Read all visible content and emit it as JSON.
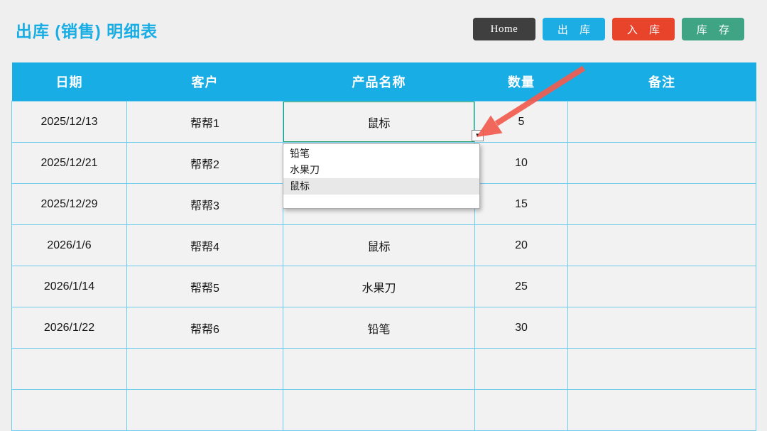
{
  "page": {
    "title": "出库 (销售) 明细表"
  },
  "toolbar": {
    "buttons": [
      {
        "label": "Home",
        "color": "#3f3f3f"
      },
      {
        "label": "出 库",
        "color": "#1cade4"
      },
      {
        "label": "入 库",
        "color": "#e8432b"
      },
      {
        "label": "库 存",
        "color": "#3ea484"
      }
    ]
  },
  "table": {
    "headers": [
      "日期",
      "客户",
      "产品名称",
      "数量",
      "备注"
    ],
    "rows": [
      {
        "date": "2025/12/13",
        "customer": "帮帮1",
        "product": "鼠标",
        "qty": "5",
        "note": ""
      },
      {
        "date": "2025/12/21",
        "customer": "帮帮2",
        "product": "",
        "qty": "10",
        "note": ""
      },
      {
        "date": "2025/12/29",
        "customer": "帮帮3",
        "product": "",
        "qty": "15",
        "note": ""
      },
      {
        "date": "2026/1/6",
        "customer": "帮帮4",
        "product": "鼠标",
        "qty": "20",
        "note": ""
      },
      {
        "date": "2026/1/14",
        "customer": "帮帮5",
        "product": "水果刀",
        "qty": "25",
        "note": ""
      },
      {
        "date": "2026/1/22",
        "customer": "帮帮6",
        "product": "铅笔",
        "qty": "30",
        "note": ""
      },
      {
        "date": "",
        "customer": "",
        "product": "",
        "qty": "",
        "note": ""
      },
      {
        "date": "",
        "customer": "",
        "product": "",
        "qty": "",
        "note": ""
      }
    ]
  },
  "dropdown": {
    "options": [
      "铅笔",
      "水果刀",
      "鼠标"
    ],
    "selected": "鼠标"
  },
  "icons": {
    "caret_down": "▼"
  },
  "colors": {
    "accent_cyan": "#1cade4",
    "button_home": "#3f3f3f",
    "button_outbound": "#1cade4",
    "button_inbound": "#e8432b",
    "button_stock": "#3ea484",
    "grid_line": "#6ecbec",
    "selection_border": "#1f9e62",
    "arrow_red": "#f15b4e",
    "page_background": "#efefef",
    "cell_background": "#f2f2f2",
    "header_text": "#ffffff"
  }
}
